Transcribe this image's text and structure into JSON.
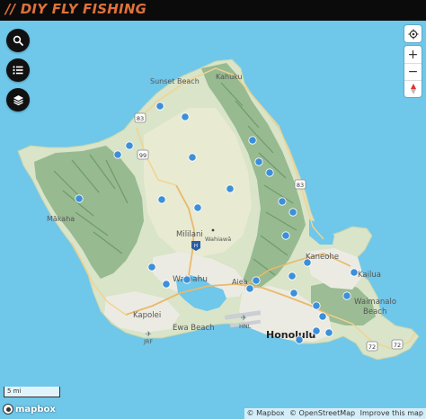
{
  "brand": {
    "title": "// DIY FLY FISHING"
  },
  "left_controls": [
    {
      "name": "search-button",
      "icon": "search-icon"
    },
    {
      "name": "list-button",
      "icon": "list-icon"
    },
    {
      "name": "layers-button",
      "icon": "layers-icon"
    }
  ],
  "map_controls": {
    "geolocate_icon": "crosshair-icon",
    "zoom_in": "+",
    "zoom_out": "−",
    "compass_icon": "compass-icon"
  },
  "places": {
    "sunset_beach": "Sunset Beach",
    "kahuku": "Kahuku",
    "makaha": "Mākaha",
    "mililani": "Mililani",
    "wahiawa": "Wahiawā",
    "wahiawa_small": "Wahiawā",
    "waipahu": "Waipahu",
    "aiea": "Aiea",
    "kapolei": "Kapolei",
    "ewa_beach": "Ewa Beach",
    "kaneohe": "Kaneohe",
    "kailua": "Kailua",
    "waimanalo": "Waimanalo",
    "beach": "Beach",
    "honolulu": "Honolulu",
    "airport": "HNL",
    "jrf": "JRF"
  },
  "route_shields": [
    "83",
    "99",
    "83",
    "72",
    "72"
  ],
  "interstate_shield": "H",
  "fishing_spots": [
    "spot-1",
    "spot-2",
    "spot-3",
    "spot-4",
    "spot-5",
    "spot-6",
    "spot-7",
    "spot-8",
    "spot-9",
    "spot-10",
    "spot-11",
    "spot-12",
    "spot-13",
    "spot-14",
    "spot-15",
    "spot-16",
    "spot-17",
    "spot-18",
    "spot-19",
    "spot-20",
    "spot-21",
    "spot-22",
    "spot-23",
    "spot-24",
    "spot-25",
    "spot-26",
    "spot-27",
    "spot-28",
    "spot-29",
    "spot-30"
  ],
  "scale": {
    "label": "5 mi"
  },
  "attribution": {
    "logo_text": "mapbox",
    "mapbox": "© Mapbox",
    "osm": "© OpenStreetMap",
    "improve": "Improve this map"
  },
  "colors": {
    "water": "#6fc7ea",
    "land": "#d9e4c8",
    "mountains": "#8fb58b",
    "urban": "#ecebe3",
    "marker": "#3d8fd9",
    "brand": "#e0713a"
  }
}
